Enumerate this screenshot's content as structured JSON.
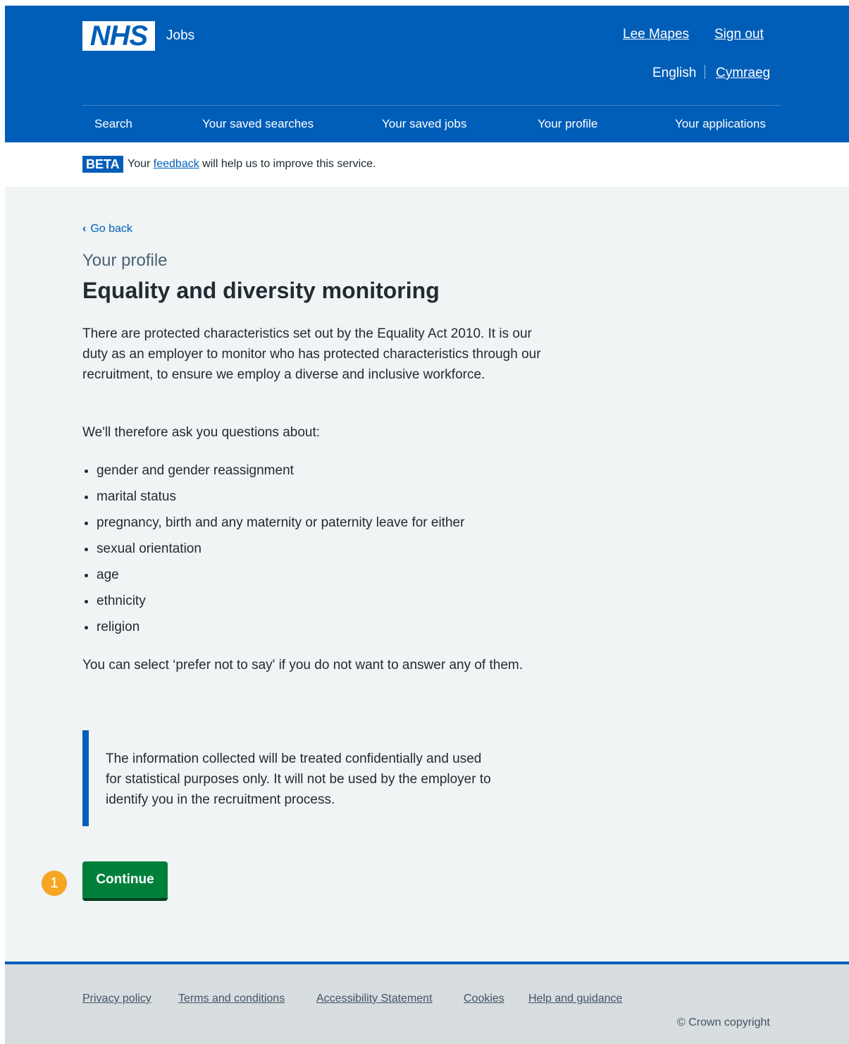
{
  "header": {
    "logo_text": "NHS",
    "service_name": "Jobs",
    "user_name": "Lee Mapes",
    "sign_out": "Sign out",
    "lang_current": "English",
    "lang_other": "Cymraeg"
  },
  "nav": {
    "items": [
      {
        "label": "Search"
      },
      {
        "label": "Your saved searches"
      },
      {
        "label": "Your saved jobs"
      },
      {
        "label": "Your profile"
      },
      {
        "label": "Your applications"
      }
    ]
  },
  "beta": {
    "tag": "BETA",
    "text_before": "Your",
    "link": "feedback",
    "text_after": "will help us to improve this service."
  },
  "main": {
    "back_label": "Go back",
    "caption": "Your profile",
    "title": "Equality and diversity monitoring",
    "intro": "There are protected characteristics set out by the Equality Act 2010. It is our duty as an employer to monitor who has protected characteristics through our recruitment, to ensure we employ a diverse and inclusive workforce.",
    "ask_intro": "We'll therefore ask you questions about:",
    "bullets": [
      "gender and gender reassignment",
      "marital status",
      "pregnancy, birth and any maternity or paternity leave for either",
      "sexual orientation",
      "age",
      "ethnicity",
      "religion"
    ],
    "prefer_not": "You can select ‘prefer not to say' if you do not want to answer any of them.",
    "inset": "The information collected will be treated confidentially and used for statistical purposes only. It will not be used by the employer to identify you in the recruitment process.",
    "step_number": "1",
    "continue_label": "Continue"
  },
  "footer": {
    "links": [
      {
        "label": "Privacy policy"
      },
      {
        "label": "Terms and conditions"
      },
      {
        "label": "Accessibility Statement"
      },
      {
        "label": "Cookies"
      },
      {
        "label": "Help and guidance"
      }
    ],
    "copyright": "© Crown copyright"
  },
  "colors": {
    "brand_blue": "#005eb8",
    "button_green": "#007f3b",
    "step_badge": "#f6a623",
    "page_bg": "#f0f4f5",
    "footer_bg": "#d8dde0"
  }
}
